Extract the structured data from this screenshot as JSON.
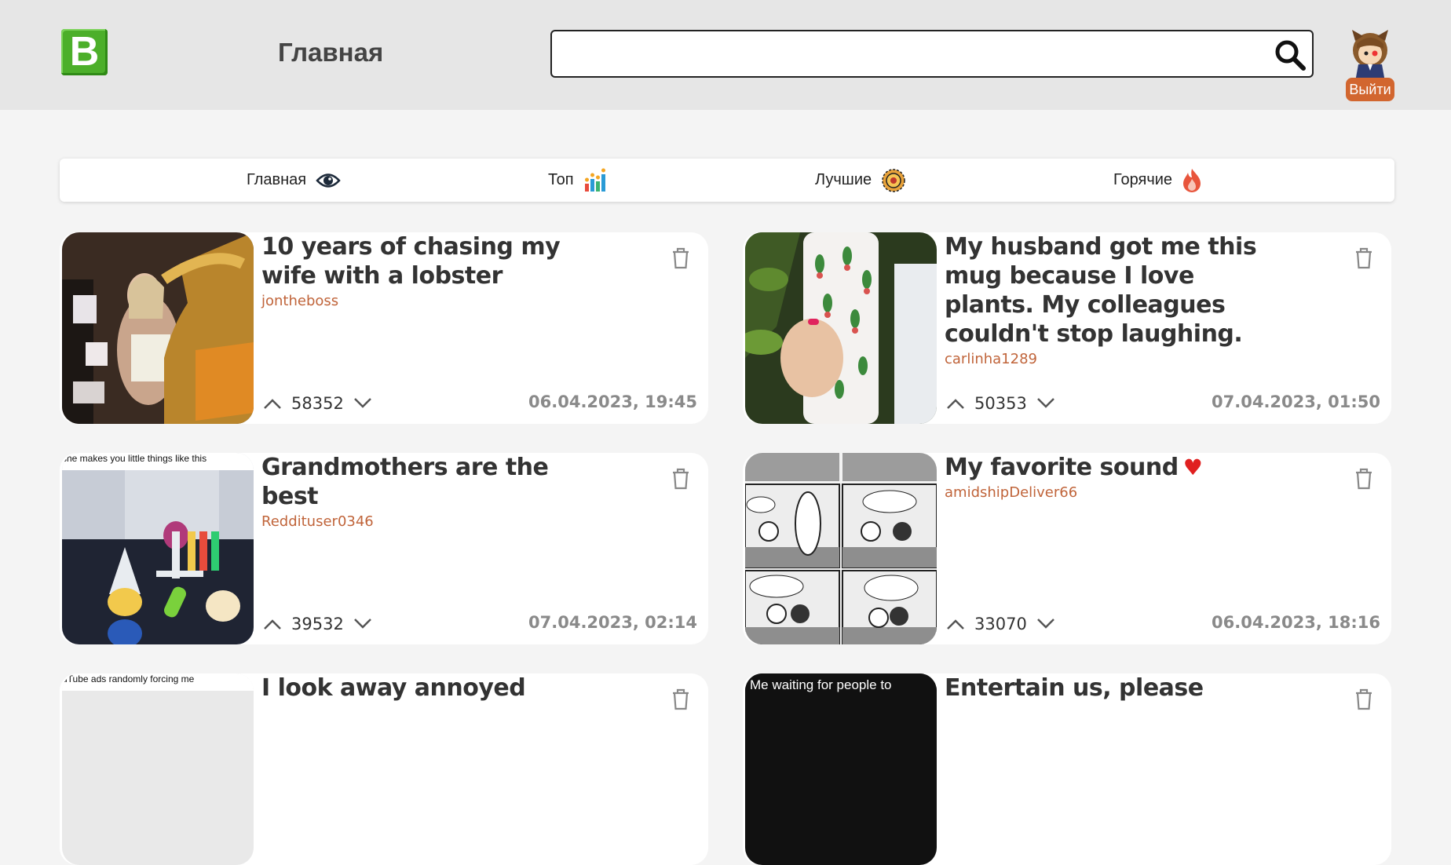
{
  "header": {
    "logo_letter": "B",
    "page_title": "Главная",
    "search": {
      "value": "",
      "placeholder": ""
    },
    "logout_label": "Выйти"
  },
  "tabs": [
    {
      "label": "Главная",
      "icon": "eye-icon"
    },
    {
      "label": "Топ",
      "icon": "bar-chart-icon"
    },
    {
      "label": "Лучшие",
      "icon": "badge-icon"
    },
    {
      "label": "Горячие",
      "icon": "fire-icon"
    }
  ],
  "posts": [
    {
      "title": "10 years of chasing my wife with a lobster",
      "author": "jontheboss",
      "votes": "58352",
      "date": "06.04.2023, 19:45"
    },
    {
      "title": "My husband got me this mug because I love plants. My colleagues couldn't stop laughing.",
      "author": "carlinha1289",
      "votes": "50353",
      "date": "07.04.2023, 01:50"
    },
    {
      "title": "Grandmothers are the best",
      "author": "Reddituser0346",
      "votes": "39532",
      "date": "07.04.2023, 02:14",
      "image_caption": "she makes you little things like this"
    },
    {
      "title": "My favorite sound",
      "author": "amidshipDeliver66",
      "votes": "33070",
      "date": "06.04.2023, 18:16"
    },
    {
      "title": "I look away annoyed",
      "image_caption": "uTube ads randomly forcing me"
    },
    {
      "title": "Entertain us, please",
      "image_caption": "Me waiting for people to"
    }
  ],
  "colors": {
    "accent": "#d2662f",
    "author": "#c0643a",
    "logo": "#4caf2a"
  }
}
